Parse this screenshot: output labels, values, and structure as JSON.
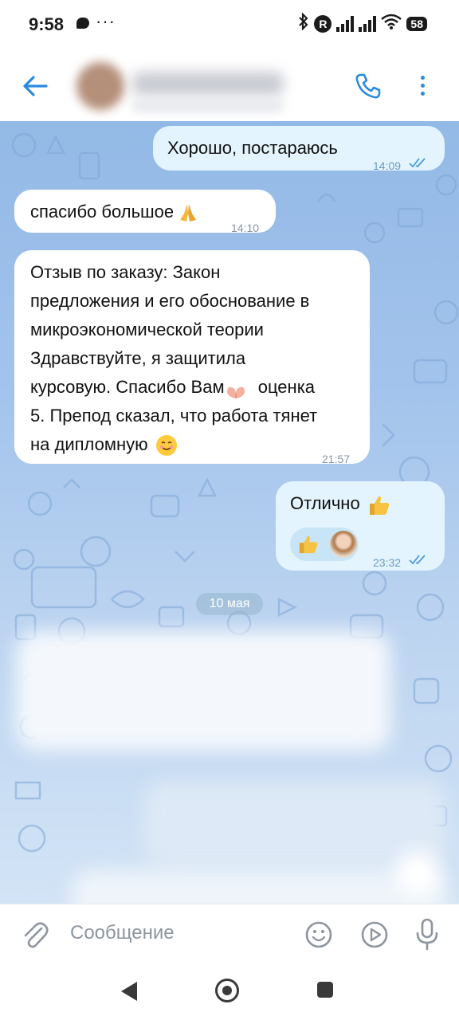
{
  "status_bar": {
    "time": "9:58",
    "dots": "···",
    "network_badge": "R",
    "battery": "58"
  },
  "header": {
    "contact_name": "",
    "contact_status": ""
  },
  "messages": [
    {
      "text": "Хорошо, постараюсь",
      "time": "14:09",
      "direction": "outgoing",
      "read": true
    },
    {
      "text": "спасибо большое",
      "time": "14:10",
      "direction": "incoming"
    },
    {
      "lines": [
        "Отзыв по заказу: Закон",
        "предложения и его обоснование в",
        "микроэкономической теории",
        "Здравствуйте, я защитила",
        "курсовую. Спасибо Вам",
        "5. Препод сказал, что работа тянет",
        "на дипломную"
      ],
      "line5_suffix": "оценка",
      "time": "21:57",
      "direction": "incoming"
    },
    {
      "text": "Отлично",
      "time": "23:32",
      "direction": "outgoing",
      "read": true,
      "reaction": "thumbs-up"
    }
  ],
  "date_separator": "10 мая",
  "composer": {
    "placeholder": "Сообщение"
  },
  "colors": {
    "accent": "#2b8be0",
    "incoming_bubble": "#ffffff",
    "outgoing_bubble": "#e4f4fe",
    "chat_bg_top": "#93b9e6",
    "chat_bg_bottom": "#d3e4f6"
  },
  "icons": {
    "back": "arrow-left-icon",
    "call": "phone-icon",
    "menu": "more-vertical-icon",
    "attach": "paperclip-icon",
    "emoji": "emoji-icon",
    "video": "play-circle-icon",
    "mic": "microphone-icon"
  }
}
